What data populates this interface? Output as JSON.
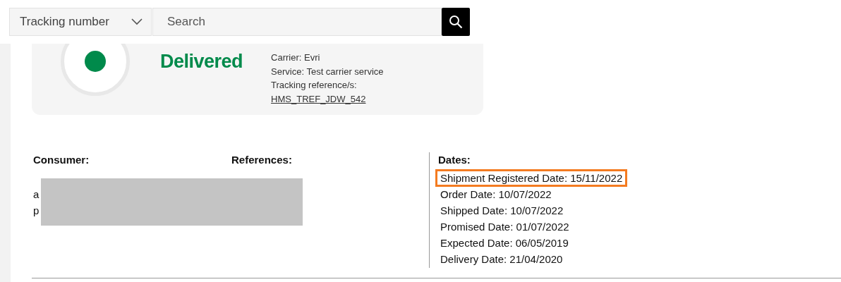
{
  "search_bar": {
    "type_select": "Tracking number",
    "search": {
      "placeholder": "Search"
    }
  },
  "status_card": {
    "status": "Delivered",
    "carrier": "Carrier: Evri",
    "service": "Service: Test carrier service",
    "tracking_label": "Tracking reference/s:",
    "tracking_link": "HMS_TREF_JDW_542"
  },
  "consumer": {
    "heading": "Consumer:",
    "lines": [
      "a",
      "p"
    ]
  },
  "references": {
    "heading": "References:"
  },
  "dates": {
    "heading": "Dates:",
    "items": [
      {
        "text": "Shipment Registered Date: 15/11/2022",
        "highlighted": true
      },
      {
        "text": "Order Date: 10/07/2022",
        "highlighted": false
      },
      {
        "text": "Shipped Date: 10/07/2022",
        "highlighted": false
      },
      {
        "text": "Promised Date: 01/07/2022",
        "highlighted": false
      },
      {
        "text": "Expected Date: 06/05/2019",
        "highlighted": false
      },
      {
        "text": "Delivery Date: 21/04/2020",
        "highlighted": false
      }
    ]
  }
}
